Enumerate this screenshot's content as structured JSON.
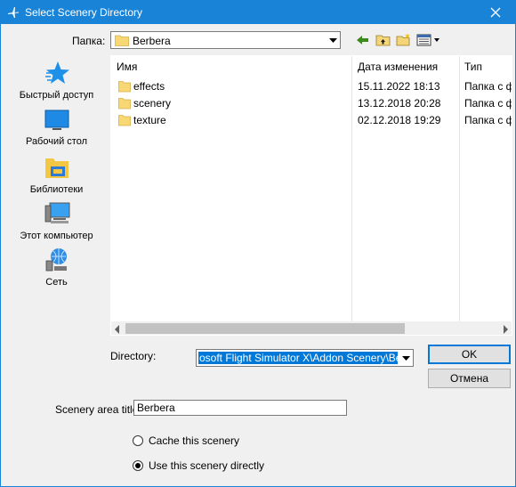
{
  "window": {
    "title": "Select Scenery Directory"
  },
  "lookin": {
    "label": "Папка:",
    "value": "Berbera"
  },
  "toolbar": {
    "icons": [
      "back-arrow-icon",
      "up-folder-icon",
      "new-folder-icon",
      "view-menu-icon"
    ]
  },
  "places": [
    {
      "label": "Быстрый доступ",
      "icon": "star-icon"
    },
    {
      "label": "Рабочий стол",
      "icon": "desktop-icon"
    },
    {
      "label": "Библиотеки",
      "icon": "libraries-icon"
    },
    {
      "label": "Этот компьютер",
      "icon": "computer-icon"
    },
    {
      "label": "Сеть",
      "icon": "network-icon"
    }
  ],
  "filelist": {
    "columns": [
      "Имя",
      "Дата изменения",
      "Тип"
    ],
    "rows": [
      {
        "name": "effects",
        "date": "15.11.2022 18:13",
        "type": "Папка с ф"
      },
      {
        "name": "scenery",
        "date": "13.12.2018 20:28",
        "type": "Папка с ф"
      },
      {
        "name": "texture",
        "date": "02.12.2018 19:29",
        "type": "Папка с ф"
      }
    ]
  },
  "directory": {
    "label": "Directory:",
    "value": "osoft Flight Simulator X\\Addon Scenery\\Berbera"
  },
  "buttons": {
    "ok": "OK",
    "cancel": "Отмена"
  },
  "title_field": {
    "label": "Scenery area title:",
    "value": "Berbera"
  },
  "options": {
    "cache": "Cache this scenery",
    "direct": "Use this scenery directly",
    "selected": "direct"
  },
  "colors": {
    "titlebar": "#1883d7",
    "selection": "#0078d7",
    "folder": "#f8d775"
  }
}
